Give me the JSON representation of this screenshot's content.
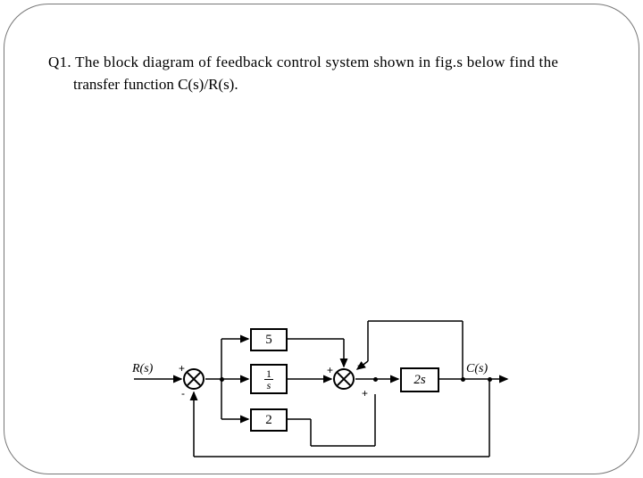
{
  "question": {
    "line1": "Q1. The block diagram of feedback control system shown in fig.s below find the",
    "line2": "transfer function C(s)/R(s)."
  },
  "diagram": {
    "input_label": "R(s)",
    "output_label": "C(s)",
    "blocks": {
      "top_gain": "5",
      "mid_gain_html": {
        "num": "1",
        "den": "s"
      },
      "bottom_gain": "2",
      "right_gain": "2s"
    },
    "signs": {
      "sum1_left_top": "+",
      "sum1_left_bottom": "-",
      "sum2_left_top": "+",
      "sum2_right_top": "-",
      "sum2_bottom": "+"
    }
  }
}
